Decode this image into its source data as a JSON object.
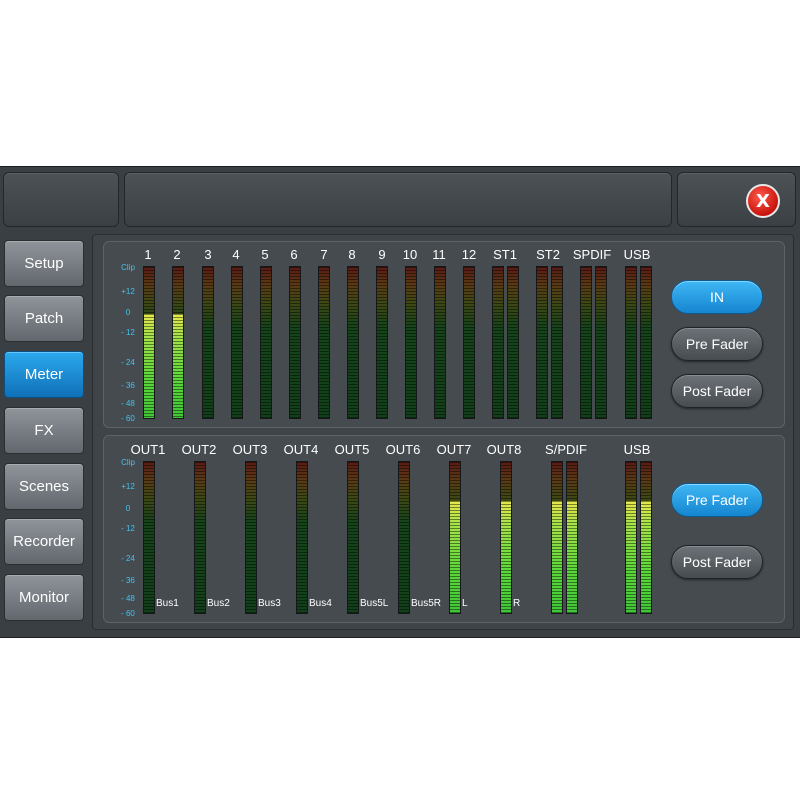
{
  "header": {
    "close_label": "X"
  },
  "sidebar": {
    "items": [
      {
        "label": "Setup",
        "active": false
      },
      {
        "label": "Patch",
        "active": false
      },
      {
        "label": "Meter",
        "active": true
      },
      {
        "label": "FX",
        "active": false
      },
      {
        "label": "Scenes",
        "active": false
      },
      {
        "label": "Recorder",
        "active": false
      },
      {
        "label": "Monitor",
        "active": false
      }
    ]
  },
  "scale": [
    "Clip",
    "+12",
    "0",
    "- 12",
    "- 24",
    "- 36",
    "- 48",
    "- 60"
  ],
  "inputs": {
    "channels": [
      {
        "label": "1",
        "levels": [
          0.69
        ]
      },
      {
        "label": "2",
        "levels": [
          0.69
        ]
      },
      {
        "label": "3",
        "levels": [
          0
        ]
      },
      {
        "label": "4",
        "levels": [
          0
        ]
      },
      {
        "label": "5",
        "levels": [
          0
        ]
      },
      {
        "label": "6",
        "levels": [
          0
        ]
      },
      {
        "label": "7",
        "levels": [
          0
        ]
      },
      {
        "label": "8",
        "levels": [
          0
        ]
      },
      {
        "label": "9",
        "levels": [
          0
        ]
      },
      {
        "label": "10",
        "levels": [
          0
        ]
      },
      {
        "label": "11",
        "levels": [
          0
        ]
      },
      {
        "label": "12",
        "levels": [
          0
        ]
      },
      {
        "label": "ST1",
        "levels": [
          0,
          0
        ]
      },
      {
        "label": "ST2",
        "levels": [
          0,
          0
        ]
      },
      {
        "label": "SPDIF",
        "levels": [
          0,
          0
        ]
      },
      {
        "label": "USB",
        "levels": [
          0,
          0
        ]
      }
    ],
    "buttons": [
      {
        "label": "IN",
        "active": true
      },
      {
        "label": "Pre Fader",
        "active": false
      },
      {
        "label": "Post Fader",
        "active": false
      }
    ]
  },
  "outputs": {
    "channels": [
      {
        "label": "OUT1",
        "bus": "Bus1",
        "levels": [
          0
        ]
      },
      {
        "label": "OUT2",
        "bus": "Bus2",
        "levels": [
          0
        ]
      },
      {
        "label": "OUT3",
        "bus": "Bus3",
        "levels": [
          0
        ]
      },
      {
        "label": "OUT4",
        "bus": "Bus4",
        "levels": [
          0
        ]
      },
      {
        "label": "OUT5",
        "bus": "Bus5L",
        "levels": [
          0
        ]
      },
      {
        "label": "OUT6",
        "bus": "Bus5R",
        "levels": [
          0
        ]
      },
      {
        "label": "OUT7",
        "bus": "L",
        "levels": [
          0.74
        ]
      },
      {
        "label": "OUT8",
        "bus": "R",
        "levels": [
          0.74
        ]
      },
      {
        "label": "S/PDIF",
        "bus": "",
        "levels": [
          0.74,
          0.74
        ]
      },
      {
        "label": "USB",
        "bus": "",
        "levels": [
          0.74,
          0.74
        ]
      }
    ],
    "buttons": [
      {
        "label": "Pre Fader",
        "active": true
      },
      {
        "label": "Post Fader",
        "active": false
      }
    ]
  }
}
